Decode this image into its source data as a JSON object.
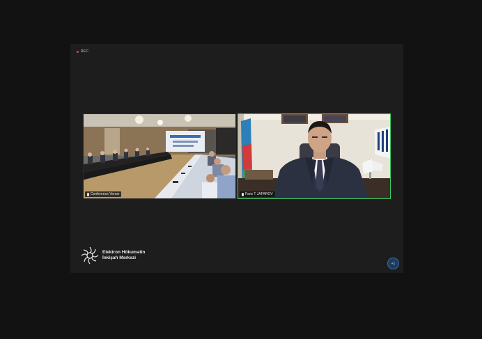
{
  "recording": {
    "label": "REC"
  },
  "participants": [
    {
      "name": "Conference Venue"
    },
    {
      "name": "Fariz T JAFAROV"
    }
  ],
  "branding": {
    "line1": "Elektron Hökumətin",
    "line2": "İnkişafı Mərkəzi"
  },
  "controls": {
    "more_label": "+1"
  },
  "colors": {
    "active_speaker_border": "#3fd26a",
    "rec_dot": "#e0463c"
  }
}
